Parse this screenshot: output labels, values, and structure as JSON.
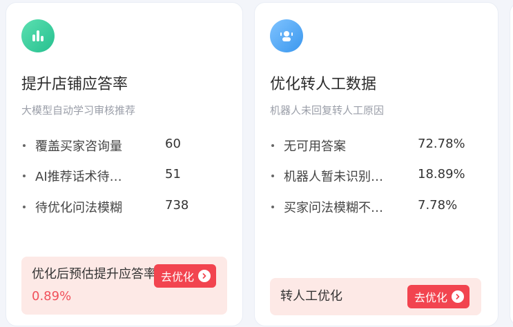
{
  "cards": [
    {
      "icon": "bar-chart-icon",
      "title": "提升店铺应答率",
      "subtitle": "大模型自动学习审核推荐",
      "metrics": [
        {
          "label": "覆盖买家咨询量",
          "value": "60"
        },
        {
          "label": "AI推荐话术待…",
          "value": "51"
        },
        {
          "label": "待优化问法模糊",
          "value": "738"
        }
      ],
      "footer": {
        "text": "优化后预估提升应答率",
        "rate": "0.89%",
        "button_label": "去优化"
      }
    },
    {
      "icon": "robot-icon",
      "title": "优化转人工数据",
      "subtitle": "机器人未回复转人工原因",
      "metrics": [
        {
          "label": "无可用答案",
          "value": "72.78%"
        },
        {
          "label": "机器人暂未识别…",
          "value": "18.89%"
        },
        {
          "label": "买家问法模糊不…",
          "value": "7.78%"
        }
      ],
      "footer": {
        "text": "转人工优化",
        "button_label": "去优化"
      }
    }
  ],
  "colors": {
    "accent_red": "#f2444f",
    "footer_bg": "#fde9e6",
    "icon_green": "#33c895",
    "icon_blue": "#4aa3f0"
  }
}
